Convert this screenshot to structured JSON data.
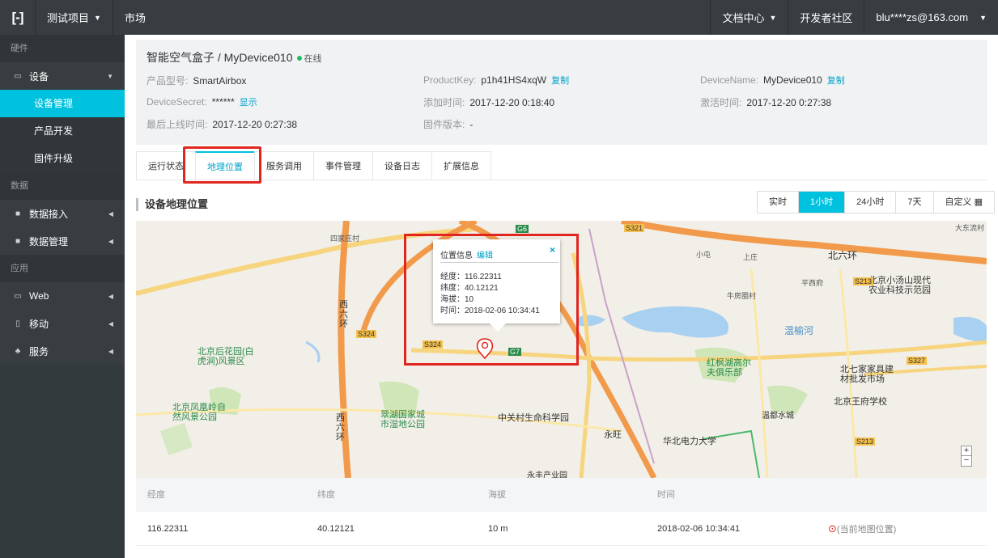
{
  "topbar": {
    "logo": "[-]",
    "project": "测试项目",
    "market": "市场",
    "docs": "文档中心",
    "community": "开发者社区",
    "user": "blu****zs@163.com"
  },
  "sidebar": {
    "section_hardware": "硬件",
    "device": "设备",
    "device_mgmt": "设备管理",
    "product_dev": "产品开发",
    "firmware": "固件升级",
    "section_data": "数据",
    "data_access": "数据接入",
    "data_mgmt": "数据管理",
    "section_app": "应用",
    "web": "Web",
    "mobile": "移动",
    "service": "服务"
  },
  "device": {
    "name": "智能空气盒子 / MyDevice010",
    "status": "在线",
    "model_label": "产品型号:",
    "model": "SmartAirbox",
    "pk_label": "ProductKey:",
    "pk": "p1h41HS4xqW",
    "copy": "复制",
    "dn_label": "DeviceName:",
    "dn": "MyDevice010",
    "secret_label": "DeviceSecret:",
    "secret": "******",
    "show": "显示",
    "added_label": "添加时间:",
    "added": "2017-12-20 0:18:40",
    "activated_label": "激活时间:",
    "activated": "2017-12-20 0:27:38",
    "last_label": "最后上线时间:",
    "last": "2017-12-20 0:27:38",
    "fw_label": "固件版本:",
    "fw": "-"
  },
  "tabs": [
    "运行状态",
    "地理位置",
    "服务调用",
    "事件管理",
    "设备日志",
    "扩展信息"
  ],
  "section_title": "设备地理位置",
  "range": [
    "实时",
    "1小时",
    "24小时",
    "7天",
    "自定义"
  ],
  "popup": {
    "title": "位置信息",
    "edit": "编辑",
    "close": "×",
    "lng": "经度：116.22311",
    "lat": "纬度：40.12121",
    "alt": "海拔：10",
    "time": "时间：2018-02-06 10:34:41"
  },
  "map_labels": {
    "sixth_ring": "北六环",
    "west_ring": "西六环",
    "west_ring2": "西六环",
    "houhuayuan": "北京后花园(白虎涧)风景区",
    "fenghuangling": "北京凤凰岭自然风景公园",
    "cuihu": "翠湖国家城市湿地公园",
    "zgc": "中关村生命科学园",
    "yongwang": "永旺",
    "ncepu": "华北电力大学",
    "honglin": "红枫湖高尔夫俱乐部",
    "xiaotangshan": "北京小汤山现代农业科技示范园",
    "beiqijia": "北七家家具建材批发市场",
    "wangfu": "北京王府学校",
    "wenyuhe": "温榆河",
    "wendu": "温都水城",
    "sijiaqing": "四家庄村",
    "xiaotuo": "小屯",
    "niufangquan": "牛房圈村",
    "beidongcun": "大东流村",
    "lizhuang": "平西府",
    "yongfeng": "永丰产业园",
    "shangzhuang": "上庄",
    "g6": "G6",
    "g7": "G7",
    "s324": "S324",
    "s321": "S321",
    "s213": "S213",
    "s327": "S327"
  },
  "table": {
    "headers": {
      "lng": "经度",
      "lat": "纬度",
      "alt": "海拔",
      "time": "时间"
    },
    "row": {
      "lng": "116.22311",
      "lat": "40.12121",
      "alt": "10 m",
      "time": "2018-02-06 10:34:41",
      "loc": "(当前地图位置)"
    }
  },
  "zoom": {
    "in": "+",
    "out": "−"
  }
}
